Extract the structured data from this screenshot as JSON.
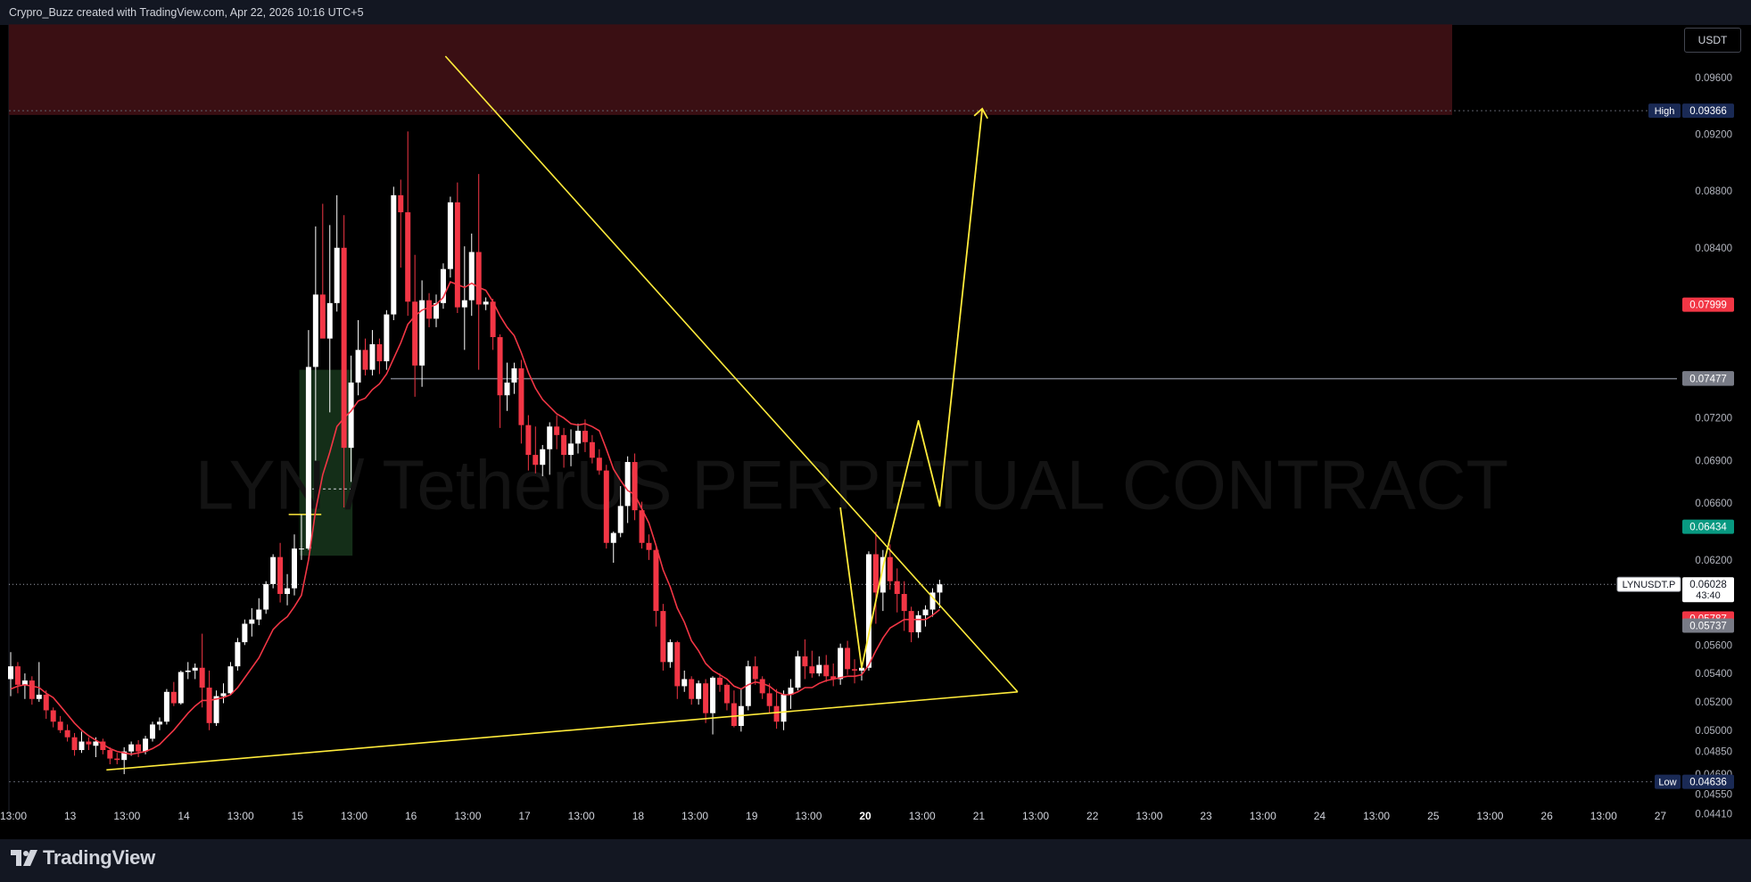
{
  "header": {
    "credit": "Crypro_Buzz created with TradingView.com, Apr 22, 2026 10:16 UTC+5"
  },
  "footer": {
    "logo_text": "TradingView"
  },
  "currency": "USDT",
  "watermark": "LYN / TetherUS PERPETUAL CONTRACT",
  "colors": {
    "up": "#ffffff",
    "down": "#f23645",
    "ma": "#f23645",
    "trend": "#ffeb3b",
    "zone": "#3a0f13",
    "green_zone": "#1b3d20",
    "price_tag_green": "#089981"
  },
  "chart_data": {
    "type": "candlestick",
    "symbol": "LYNUSDT.P",
    "interval": "4h",
    "x_labels": [
      "13:00",
      "13",
      "13:00",
      "14",
      "13:00",
      "15",
      "13:00",
      "16",
      "13:00",
      "17",
      "13:00",
      "18",
      "13:00",
      "19",
      "13:00",
      "20",
      "13:00",
      "21",
      "13:00",
      "22",
      "13:00",
      "23",
      "13:00",
      "24",
      "13:00",
      "25",
      "13:00",
      "26",
      "13:00",
      "27"
    ],
    "y_ticks": [
      "0.09600",
      "0.09200",
      "0.08800",
      "0.08400",
      "0.07999",
      "0.07480",
      "0.07200",
      "0.06900",
      "0.06600",
      "0.06434",
      "0.06200",
      "0.06028",
      "0.05787",
      "0.05600",
      "0.05400",
      "0.05200",
      "0.05000",
      "0.04850",
      "0.04690",
      "0.04550",
      "0.04410"
    ],
    "ylim": [
      0.0437,
      0.0997
    ],
    "candles": [
      [
        0.0536,
        0.0555,
        0.0524,
        0.0545
      ],
      [
        0.0545,
        0.0548,
        0.0526,
        0.0532
      ],
      [
        0.0532,
        0.054,
        0.0522,
        0.0535
      ],
      [
        0.0535,
        0.0538,
        0.0518,
        0.0522
      ],
      [
        0.0522,
        0.0548,
        0.052,
        0.0525
      ],
      [
        0.0525,
        0.0528,
        0.0508,
        0.0514
      ],
      [
        0.0514,
        0.0516,
        0.0502,
        0.0506
      ],
      [
        0.0506,
        0.051,
        0.0498,
        0.05
      ],
      [
        0.05,
        0.0504,
        0.0492,
        0.0495
      ],
      [
        0.0495,
        0.0498,
        0.0482,
        0.0486
      ],
      [
        0.0486,
        0.0499,
        0.0484,
        0.0492
      ],
      [
        0.0492,
        0.0495,
        0.0486,
        0.049
      ],
      [
        0.0489,
        0.0495,
        0.0481,
        0.0492
      ],
      [
        0.0492,
        0.0494,
        0.0483,
        0.0486
      ],
      [
        0.0486,
        0.0488,
        0.0476,
        0.048
      ],
      [
        0.048,
        0.0484,
        0.0476,
        0.0479
      ],
      [
        0.0479,
        0.0488,
        0.0469,
        0.0485
      ],
      [
        0.0485,
        0.0492,
        0.0482,
        0.049
      ],
      [
        0.049,
        0.0493,
        0.0481,
        0.0485
      ],
      [
        0.0485,
        0.0496,
        0.0483,
        0.0494
      ],
      [
        0.0494,
        0.0506,
        0.0492,
        0.0504
      ],
      [
        0.0504,
        0.0509,
        0.05,
        0.0506
      ],
      [
        0.0506,
        0.0529,
        0.0504,
        0.0527
      ],
      [
        0.0527,
        0.0534,
        0.0517,
        0.0519
      ],
      [
        0.0519,
        0.0542,
        0.0518,
        0.0541
      ],
      [
        0.0541,
        0.0548,
        0.0536,
        0.0542
      ],
      [
        0.0542,
        0.0547,
        0.0536,
        0.0544
      ],
      [
        0.0544,
        0.0568,
        0.0516,
        0.053
      ],
      [
        0.053,
        0.0542,
        0.05,
        0.0505
      ],
      [
        0.0505,
        0.0528,
        0.0503,
        0.0524
      ],
      [
        0.0524,
        0.0533,
        0.0519,
        0.0526
      ],
      [
        0.0526,
        0.0548,
        0.0525,
        0.0545
      ],
      [
        0.0545,
        0.0565,
        0.0542,
        0.0562
      ],
      [
        0.0562,
        0.0578,
        0.056,
        0.0575
      ],
      [
        0.0575,
        0.0586,
        0.0566,
        0.0578
      ],
      [
        0.0578,
        0.0593,
        0.0574,
        0.0585
      ],
      [
        0.0585,
        0.0605,
        0.0582,
        0.0603
      ],
      [
        0.0603,
        0.0624,
        0.06,
        0.0622
      ],
      [
        0.0622,
        0.0632,
        0.059,
        0.0596
      ],
      [
        0.0596,
        0.061,
        0.0588,
        0.06
      ],
      [
        0.06,
        0.0638,
        0.0595,
        0.0628
      ],
      [
        0.0628,
        0.0652,
        0.062,
        0.0628
      ],
      [
        0.0628,
        0.0782,
        0.0627,
        0.0756
      ],
      [
        0.0756,
        0.0855,
        0.069,
        0.0807
      ],
      [
        0.0807,
        0.0871,
        0.0785,
        0.0776
      ],
      [
        0.0776,
        0.0856,
        0.0724,
        0.0801
      ],
      [
        0.0801,
        0.0877,
        0.0795,
        0.084
      ],
      [
        0.084,
        0.0863,
        0.0657,
        0.0699
      ],
      [
        0.0699,
        0.0764,
        0.0675,
        0.0745
      ],
      [
        0.0745,
        0.0789,
        0.0736,
        0.0768
      ],
      [
        0.0768,
        0.0776,
        0.075,
        0.0754
      ],
      [
        0.0754,
        0.0782,
        0.075,
        0.0772
      ],
      [
        0.0772,
        0.0776,
        0.0751,
        0.076
      ],
      [
        0.076,
        0.0796,
        0.0754,
        0.0793
      ],
      [
        0.0793,
        0.0883,
        0.0789,
        0.0877
      ],
      [
        0.0877,
        0.0888,
        0.0826,
        0.0865
      ],
      [
        0.0865,
        0.0922,
        0.0792,
        0.0802
      ],
      [
        0.0802,
        0.0835,
        0.0735,
        0.0757
      ],
      [
        0.0757,
        0.0817,
        0.0742,
        0.0803
      ],
      [
        0.0803,
        0.0808,
        0.0784,
        0.079
      ],
      [
        0.079,
        0.0807,
        0.0784,
        0.0801
      ],
      [
        0.0801,
        0.0829,
        0.0797,
        0.0825
      ],
      [
        0.0825,
        0.0876,
        0.0819,
        0.0872
      ],
      [
        0.0872,
        0.0886,
        0.0794,
        0.0798
      ],
      [
        0.0798,
        0.0841,
        0.0768,
        0.0803
      ],
      [
        0.0803,
        0.085,
        0.0792,
        0.0837
      ],
      [
        0.0837,
        0.0892,
        0.0754,
        0.08
      ],
      [
        0.08,
        0.0805,
        0.0796,
        0.0802
      ],
      [
        0.0802,
        0.0804,
        0.0768,
        0.0777
      ],
      [
        0.0777,
        0.0779,
        0.0713,
        0.0736
      ],
      [
        0.0736,
        0.0759,
        0.0725,
        0.0745
      ],
      [
        0.0745,
        0.0759,
        0.0737,
        0.0755
      ],
      [
        0.0755,
        0.0761,
        0.0702,
        0.0715
      ],
      [
        0.0715,
        0.0722,
        0.0683,
        0.0694
      ],
      [
        0.0694,
        0.0714,
        0.0681,
        0.0687
      ],
      [
        0.0687,
        0.0701,
        0.0679,
        0.0698
      ],
      [
        0.0698,
        0.0717,
        0.068,
        0.0714
      ],
      [
        0.0714,
        0.0722,
        0.0698,
        0.0708
      ],
      [
        0.0708,
        0.0713,
        0.0685,
        0.0694
      ],
      [
        0.0694,
        0.0712,
        0.0686,
        0.0702
      ],
      [
        0.0702,
        0.0716,
        0.0695,
        0.0711
      ],
      [
        0.0711,
        0.0719,
        0.0696,
        0.0703
      ],
      [
        0.0703,
        0.0708,
        0.0688,
        0.0692
      ],
      [
        0.0692,
        0.0698,
        0.068,
        0.0683
      ],
      [
        0.0683,
        0.0687,
        0.0628,
        0.0632
      ],
      [
        0.0632,
        0.064,
        0.0618,
        0.0639
      ],
      [
        0.0639,
        0.0672,
        0.0636,
        0.0658
      ],
      [
        0.0658,
        0.0693,
        0.0646,
        0.0689
      ],
      [
        0.0689,
        0.0695,
        0.0648,
        0.0655
      ],
      [
        0.0655,
        0.0661,
        0.0628,
        0.0632
      ],
      [
        0.0632,
        0.0638,
        0.062,
        0.0627
      ],
      [
        0.0627,
        0.063,
        0.0573,
        0.0584
      ],
      [
        0.0584,
        0.0589,
        0.0542,
        0.0548
      ],
      [
        0.0548,
        0.0564,
        0.0544,
        0.0562
      ],
      [
        0.0562,
        0.0563,
        0.0522,
        0.0531
      ],
      [
        0.0531,
        0.0542,
        0.0527,
        0.0536
      ],
      [
        0.0536,
        0.0538,
        0.0518,
        0.0522
      ],
      [
        0.0522,
        0.0535,
        0.0518,
        0.0533
      ],
      [
        0.0533,
        0.0536,
        0.0505,
        0.0512
      ],
      [
        0.0512,
        0.0538,
        0.0497,
        0.0537
      ],
      [
        0.0537,
        0.054,
        0.0527,
        0.0532
      ],
      [
        0.0532,
        0.0533,
        0.0514,
        0.0519
      ],
      [
        0.0519,
        0.0528,
        0.0502,
        0.0503
      ],
      [
        0.0503,
        0.0529,
        0.0499,
        0.0517
      ],
      [
        0.0517,
        0.0549,
        0.0514,
        0.0545
      ],
      [
        0.0545,
        0.0552,
        0.0532,
        0.0536
      ],
      [
        0.0536,
        0.0538,
        0.0522,
        0.0526
      ],
      [
        0.0526,
        0.0533,
        0.0512,
        0.0517
      ],
      [
        0.0517,
        0.0529,
        0.0501,
        0.0506
      ],
      [
        0.0506,
        0.0528,
        0.05,
        0.0525
      ],
      [
        0.0525,
        0.0536,
        0.0515,
        0.053
      ],
      [
        0.053,
        0.0556,
        0.0528,
        0.0552
      ],
      [
        0.0552,
        0.0564,
        0.0536,
        0.0545
      ],
      [
        0.0545,
        0.0556,
        0.0537,
        0.054
      ],
      [
        0.054,
        0.0552,
        0.0538,
        0.0546
      ],
      [
        0.0546,
        0.0553,
        0.0534,
        0.0538
      ],
      [
        0.0538,
        0.0547,
        0.0531,
        0.0536
      ],
      [
        0.0536,
        0.0561,
        0.0532,
        0.0558
      ],
      [
        0.0558,
        0.0563,
        0.0539,
        0.0543
      ],
      [
        0.0543,
        0.055,
        0.0533,
        0.0542
      ],
      [
        0.0542,
        0.0545,
        0.0535,
        0.0544
      ],
      [
        0.0544,
        0.0626,
        0.0542,
        0.0624
      ],
      [
        0.0624,
        0.064,
        0.0575,
        0.0597
      ],
      [
        0.0597,
        0.0627,
        0.0584,
        0.0622
      ],
      [
        0.0622,
        0.0631,
        0.0599,
        0.0605
      ],
      [
        0.0605,
        0.0614,
        0.0583,
        0.0596
      ],
      [
        0.0596,
        0.0605,
        0.057,
        0.0584
      ],
      [
        0.0584,
        0.0587,
        0.0562,
        0.0569
      ],
      [
        0.0569,
        0.0584,
        0.0565,
        0.0581
      ],
      [
        0.0581,
        0.0588,
        0.0573,
        0.0585
      ],
      [
        0.0585,
        0.06,
        0.058,
        0.0597
      ],
      [
        0.0597,
        0.0606,
        0.0586,
        0.06028
      ]
    ],
    "moving_average": [
      0.0529,
      0.0531,
      0.0532,
      0.0531,
      0.053,
      0.0526,
      0.0523,
      0.0517,
      0.0511,
      0.0505,
      0.05,
      0.0496,
      0.0493,
      0.049,
      0.0487,
      0.0485,
      0.0484,
      0.0483,
      0.0484,
      0.0485,
      0.0487,
      0.049,
      0.0495,
      0.05,
      0.0506,
      0.0512,
      0.0517,
      0.0521,
      0.0521,
      0.0522,
      0.0523,
      0.0525,
      0.053,
      0.0537,
      0.0544,
      0.0551,
      0.0561,
      0.0571,
      0.0576,
      0.058,
      0.0587,
      0.0595,
      0.062,
      0.0655,
      0.068,
      0.0696,
      0.0714,
      0.072,
      0.0725,
      0.0732,
      0.0734,
      0.074,
      0.0744,
      0.0751,
      0.0762,
      0.0773,
      0.0786,
      0.0792,
      0.0796,
      0.0798,
      0.08,
      0.0805,
      0.0816,
      0.0814,
      0.0812,
      0.0815,
      0.0812,
      0.081,
      0.0802,
      0.0792,
      0.0784,
      0.0778,
      0.0766,
      0.0752,
      0.0741,
      0.0733,
      0.0728,
      0.0723,
      0.072,
      0.0716,
      0.0715,
      0.0716,
      0.0714,
      0.0711,
      0.0698,
      0.0684,
      0.0676,
      0.0669,
      0.0666,
      0.0656,
      0.0646,
      0.063,
      0.0613,
      0.0601,
      0.0586,
      0.0576,
      0.0563,
      0.0556,
      0.0547,
      0.0542,
      0.0539,
      0.0536,
      0.0531,
      0.0529,
      0.0532,
      0.0534,
      0.0533,
      0.0531,
      0.0527,
      0.0525,
      0.0525,
      0.0527,
      0.053,
      0.053,
      0.0533,
      0.0535,
      0.0536,
      0.0537,
      0.0538,
      0.0538,
      0.0539,
      0.0546,
      0.0556,
      0.0565,
      0.0572,
      0.0575,
      0.0578,
      0.0578,
      0.0578,
      0.0578,
      0.0581,
      0.0585
    ],
    "price_labels": [
      {
        "value": 0.09366,
        "text": "0.09366",
        "side_label": "High",
        "bg": "#1a2a55"
      },
      {
        "value": 0.07999,
        "text": "0.07999",
        "bg": "#f23645"
      },
      {
        "value": 0.0748,
        "text": "0.07480",
        "bg": "#787b86"
      },
      {
        "value": 0.07477,
        "text": "0.07477",
        "bg": "#787b86"
      },
      {
        "value": 0.06434,
        "text": "0.06434",
        "bg": "#089981"
      },
      {
        "value": 0.06028,
        "text": "0.06028",
        "side_label": "LYNUSDT.P",
        "sub": "43:40",
        "bg": "#ffffff",
        "fg": "#131722"
      },
      {
        "value": 0.05787,
        "text": "0.05787",
        "bg": "#f23645"
      },
      {
        "value": 0.05737,
        "text": "0.05737",
        "bg": "#787b86"
      },
      {
        "value": 0.04636,
        "text": "0.04636",
        "side_label": "Low",
        "bg": "#1a2a55"
      }
    ],
    "horizontal_lines": [
      0.09366,
      0.07477,
      0.06028,
      0.04636
    ],
    "resistance_zone": [
      0.09336,
      0.09974
    ],
    "trendlines": [
      {
        "from": [
          0,
          0.0975
        ],
        "to": [
          142,
          0.0527
        ]
      },
      {
        "from": [
          9,
          0.0472
        ],
        "to": [
          142,
          0.0527
        ]
      }
    ],
    "projection_path": [
      [
        117,
        0.0657
      ],
      [
        120,
        0.0544
      ],
      [
        123,
        0.0615
      ],
      [
        128,
        0.0718
      ],
      [
        131,
        0.0658
      ],
      [
        137,
        0.0938
      ]
    ],
    "grid": false,
    "legend": "none"
  }
}
